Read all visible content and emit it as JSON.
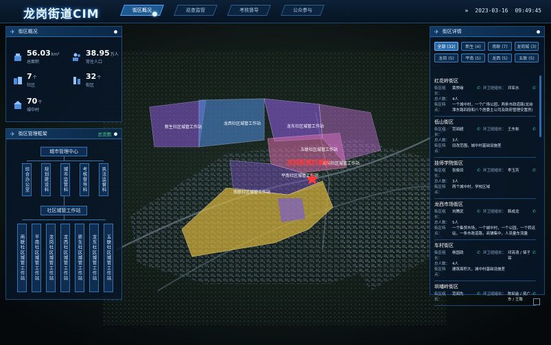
{
  "app": {
    "title": "龙岗街道CIM"
  },
  "nav": {
    "tabs": [
      {
        "label": "街区概况",
        "active": true
      },
      {
        "label": "巡查监管",
        "active": false
      },
      {
        "label": "考核督导",
        "active": false
      },
      {
        "label": "公众参与",
        "active": false
      }
    ]
  },
  "header": {
    "date": "2023-03-16",
    "time": "09:49:45"
  },
  "overview": {
    "title": "街区概况",
    "stats": [
      {
        "value": "56.03",
        "unit": "km²",
        "label": "总面积"
      },
      {
        "value": "38.95",
        "unit": "万人",
        "label": "常住人口"
      },
      {
        "value": "7",
        "unit": "个",
        "label": "社区"
      },
      {
        "value": "32",
        "unit": "个",
        "label": "街区"
      },
      {
        "value": "70",
        "unit": "个",
        "label": "城中村"
      }
    ]
  },
  "org": {
    "title": "街区管理框架",
    "more": "总览图",
    "center": "城市管理中心",
    "departments": [
      "综合办公室",
      "规划建设科",
      "城市监管科",
      "考核督导科",
      "执法监督科"
    ],
    "office": "社区城管工作站",
    "stations": [
      "南联社区城管工作站",
      "平南社区城管工作站",
      "龙岗社区城管工作站",
      "龙西社区城管工作站",
      "新生社区城管工作站",
      "龙东社区城管工作站",
      "五联社区城管工作站"
    ]
  },
  "map": {
    "labels": [
      "龙岗街道办事处",
      "新生社区城管工作站",
      "龙西社区城管工作站",
      "龙东社区城管工作站",
      "五联社区城管工作站",
      "龙岗社区城管工作站",
      "平南社区城管工作站",
      "南联社区城管工作站"
    ]
  },
  "details": {
    "title": "街区详情",
    "filters": [
      {
        "label": "全部 (32)",
        "active": true
      },
      {
        "label": "新生 (4)",
        "active": false
      },
      {
        "label": "南联 (7)",
        "active": false
      },
      {
        "label": "龙岗城 (3)",
        "active": false
      },
      {
        "label": "龙岗 (5)",
        "active": false
      },
      {
        "label": "平南 (5)",
        "active": false
      },
      {
        "label": "龙西 (5)",
        "active": false
      },
      {
        "label": "五联 (5)",
        "active": false
      }
    ],
    "items": [
      {
        "name": "红花岭街区",
        "leader": "黄崇缘",
        "worker": "邓亚水",
        "count": "4人",
        "feature": "一个城中村，一个广场公园，两条市政道路(龙岗潭东路四段和八个居委主公司及政府管理安置房)"
      },
      {
        "name": "低山街区",
        "leader": "范闻超",
        "worker": "王东彬",
        "count": "3人",
        "feature": "旧改范围，城中村基础设施差"
      },
      {
        "name": "技师学院街区",
        "leader": "张俊田",
        "worker": "李玉芳",
        "count": "3人",
        "feature": "两个城中村，学校区域"
      },
      {
        "name": "龙西市场街区",
        "leader": "刘腾武",
        "worker": "韩成龙",
        "count": "5人",
        "feature": "一个集贸市场，一个城中村，一个公园，一个转运站，一条市政道路，商铺集中，人流量车流量"
      },
      {
        "name": "车村街区",
        "leader": "杨国政",
        "worker": "邓亮浪 / 邹子琛",
        "count": "4人",
        "feature": "建筑面积大，城中村基础设施差"
      },
      {
        "name": "圳埔岭街区",
        "leader": "范闻先",
        "worker": "陈如金 / 吴广东 / 王致",
        "count": "",
        "feature": ""
      }
    ],
    "keys": {
      "leader": "街区组长：",
      "worker": "环卫班组长：",
      "count": "总人数：",
      "feature": "街区特点："
    }
  },
  "colors": {
    "accent": "#2a8cff",
    "highlight": "#ff3b3b",
    "district_yellow": "#d8b43c",
    "district_purple": "#8a5ad8",
    "district_pink": "#d86aa8",
    "district_blue": "#4f8fe0"
  }
}
